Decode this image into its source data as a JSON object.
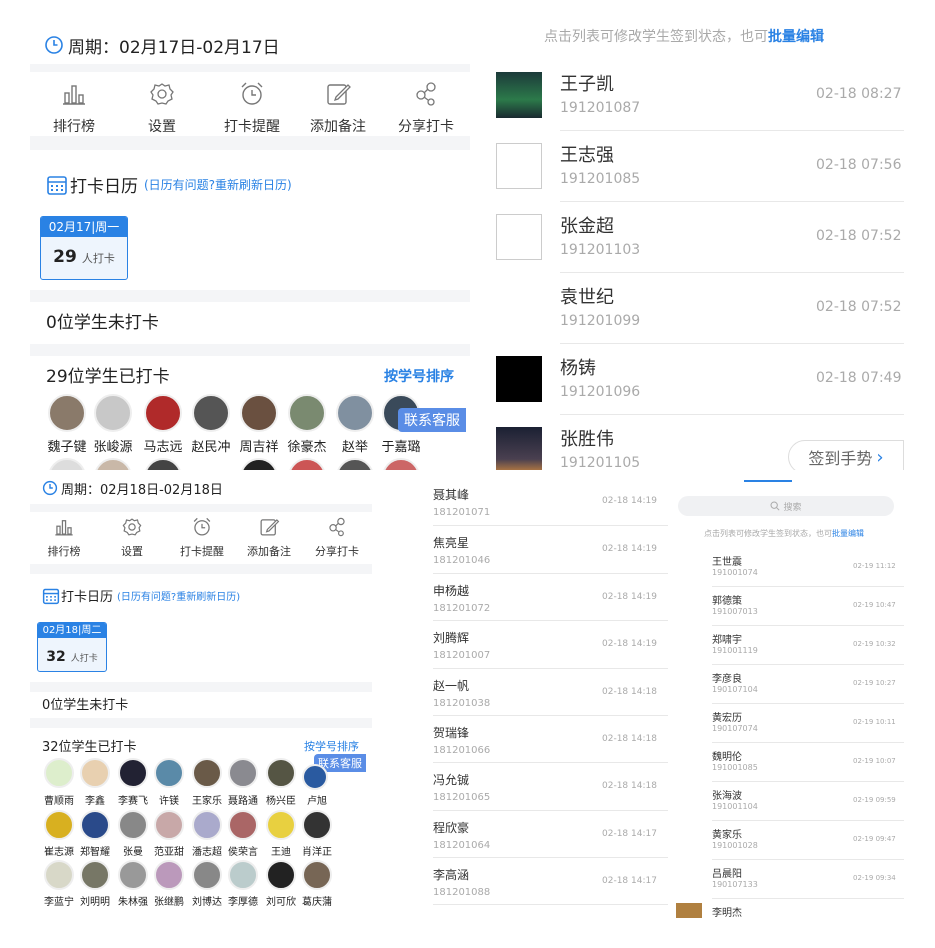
{
  "top_left": {
    "period_label": "周期：02月17日-02月17日",
    "tools": [
      "排行榜",
      "设置",
      "打卡提醒",
      "添加备注",
      "分享打卡"
    ],
    "calendar_title": "打卡日历",
    "calendar_hint": "(日历有问题?重新刷新日历)",
    "calendar_date": "02月17|周一",
    "calendar_count": "29",
    "calendar_count_unit": "人打卡",
    "not_checked": "0位学生未打卡",
    "checked": "29位学生已打卡",
    "sort_label": "按学号排序",
    "service_label": "联系客服",
    "names": [
      "魏子键",
      "张峻源",
      "马志远",
      "赵民冲",
      "周吉祥",
      "徐豪杰",
      "赵举",
      "于嘉璐"
    ]
  },
  "top_right": {
    "hint": "点击列表可修改学生签到状态，也可",
    "hint_link": "批量编辑",
    "rows": [
      {
        "name": "王子凯",
        "id": "191201087",
        "time": "02-18 08:27"
      },
      {
        "name": "王志强",
        "id": "191201085",
        "time": "02-18 07:56"
      },
      {
        "name": "张金超",
        "id": "191201103",
        "time": "02-18 07:52"
      },
      {
        "name": "袁世纪",
        "id": "191201099",
        "time": "02-18 07:52"
      },
      {
        "name": "杨铸",
        "id": "191201096",
        "time": "02-18 07:49"
      },
      {
        "name": "张胜伟",
        "id": "191201105",
        "time": ""
      }
    ],
    "gesture_button": "签到手势"
  },
  "bottom_left": {
    "period_label": "周期：02月18日-02月18日",
    "tools": [
      "排行榜",
      "设置",
      "打卡提醒",
      "添加备注",
      "分享打卡"
    ],
    "calendar_title": "打卡日历",
    "calendar_hint": "(日历有问题?重新刷新日历)",
    "calendar_date": "02月18|周二",
    "calendar_count": "32",
    "calendar_count_unit": "人打卡",
    "not_checked": "0位学生未打卡",
    "checked": "32位学生已打卡",
    "sort_label": "按学号排序",
    "service_label": "联系客服",
    "names_row1": [
      "曹顺雨",
      "李鑫",
      "李赛飞",
      "许镁",
      "王家乐",
      "聂路通",
      "杨兴臣",
      "卢旭"
    ],
    "names_row2": [
      "崔志源",
      "郑智耀",
      "张曼",
      "范亚甜",
      "潘志超",
      "侯荣言",
      "王迪",
      "肖洋正"
    ],
    "names_row3": [
      "李蓝宁",
      "刘明明",
      "朱林强",
      "张继鹏",
      "刘博达",
      "李厚德",
      "刘可欣",
      "葛庆蒲"
    ]
  },
  "bottom_middle": {
    "rows": [
      {
        "name": "聂其峰",
        "id": "181201071",
        "time": "02-18 14:19"
      },
      {
        "name": "焦亮星",
        "id": "181201046",
        "time": "02-18 14:19"
      },
      {
        "name": "申杨越",
        "id": "181201072",
        "time": "02-18 14:19"
      },
      {
        "name": "刘腾辉",
        "id": "181201007",
        "time": "02-18 14:19"
      },
      {
        "name": "赵一帆",
        "id": "181201038",
        "time": "02-18 14:18"
      },
      {
        "name": "贺瑞锋",
        "id": "181201066",
        "time": "02-18 14:18"
      },
      {
        "name": "冯允铖",
        "id": "181201065",
        "time": "02-18 14:18"
      },
      {
        "name": "程欣豪",
        "id": "181201064",
        "time": "02-18 14:17"
      },
      {
        "name": "李高涵",
        "id": "181201088",
        "time": "02-18 14:17"
      }
    ]
  },
  "bottom_right": {
    "search_placeholder": "搜索",
    "hint": "点击列表可修改学生签到状态，也可",
    "hint_link": "批量编辑",
    "rows": [
      {
        "name": "王世震",
        "id": "191001074",
        "time": "02-19 11:12"
      },
      {
        "name": "郭德策",
        "id": "191007013",
        "time": "02-19 10:47"
      },
      {
        "name": "郑啸宇",
        "id": "191001119",
        "time": "02-19 10:32"
      },
      {
        "name": "李彦良",
        "id": "190107104",
        "time": "02-19 10:27"
      },
      {
        "name": "黄宏历",
        "id": "190107074",
        "time": "02-19 10:11"
      },
      {
        "name": "魏明伦",
        "id": "191001085",
        "time": "02-19 10:07"
      },
      {
        "name": "张海波",
        "id": "191001104",
        "time": "02-19 09:59"
      },
      {
        "name": "黄家乐",
        "id": "191001028",
        "time": "02-19 09:47"
      },
      {
        "name": "吕晨阳",
        "id": "190107133",
        "time": "02-19 09:34"
      },
      {
        "name": "李明杰",
        "id": "",
        "time": ""
      }
    ]
  },
  "colors": {
    "accent": "#2a82e4",
    "muted": "#a9a9a9",
    "band": "#f4f5f7",
    "service_tag": "#5a8de6"
  }
}
